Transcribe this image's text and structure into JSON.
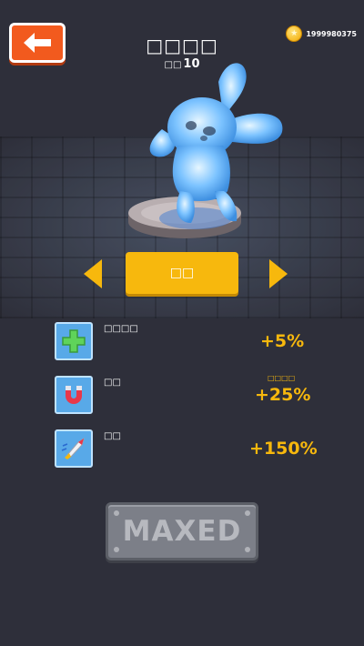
{
  "header": {
    "back_icon": "arrow-left-icon",
    "coins": "1999980375",
    "coin_icon": "gold-coin-icon"
  },
  "skin": {
    "title": "□□□□",
    "level_prefix": "□□",
    "level_value": "10"
  },
  "selector": {
    "select_label": "□□",
    "left_arrow_icon": "triangle-left-icon",
    "right_arrow_icon": "triangle-right-icon"
  },
  "stats": [
    {
      "icon": "green-cross-icon",
      "label": "□□□□",
      "value": "+5%",
      "note": ""
    },
    {
      "icon": "magnet-icon",
      "label": "□□",
      "value": "+25%",
      "note": "□□□□"
    },
    {
      "icon": "rocket-icon",
      "label": "□□",
      "value": "+150%",
      "note": ""
    }
  ],
  "action": {
    "maxed_label": "MAXED"
  },
  "colors": {
    "background": "#2e2f3a",
    "accent_yellow": "#f7b80d",
    "back_orange": "#f25a1e",
    "stat_icon_blue": "#58a9e8",
    "maxed_gray": "#7c7f88"
  }
}
